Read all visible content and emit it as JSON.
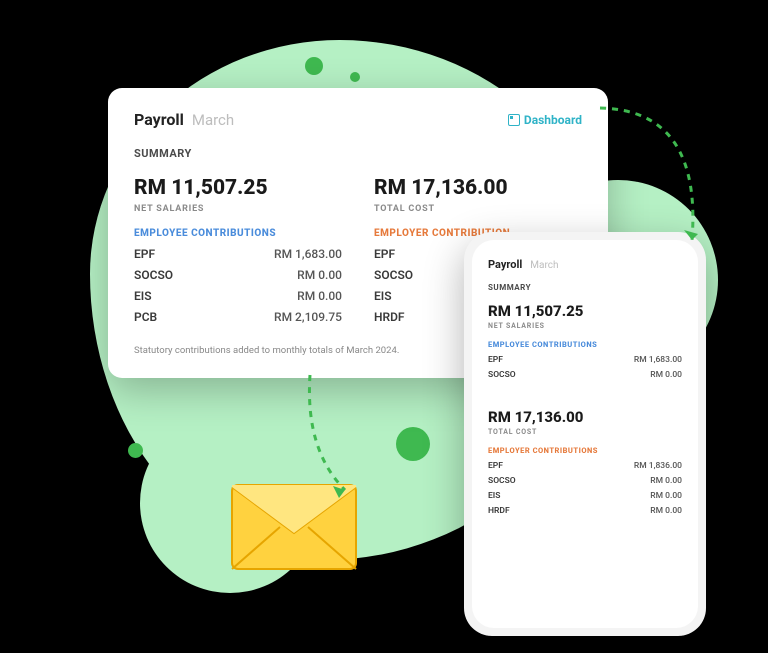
{
  "desktop": {
    "title": "Payroll",
    "month": "March",
    "dashboard_link": "Dashboard",
    "summary_label": "SUMMARY",
    "net_salaries": {
      "value": "RM 11,507.25",
      "label": "NET SALARIES"
    },
    "total_cost": {
      "value": "RM 17,136.00",
      "label": "TOTAL COST"
    },
    "employee_section": "EMPLOYEE CONTRIBUTIONS",
    "employer_section": "EMPLOYER CONTRIBUTION",
    "employee_rows": [
      {
        "label": "EPF",
        "value": "RM 1,683.00"
      },
      {
        "label": "SOCSO",
        "value": "RM 0.00"
      },
      {
        "label": "EIS",
        "value": "RM 0.00"
      },
      {
        "label": "PCB",
        "value": "RM 2,109.75"
      }
    ],
    "employer_rows": [
      {
        "label": "EPF",
        "value": ""
      },
      {
        "label": "SOCSO",
        "value": ""
      },
      {
        "label": "EIS",
        "value": ""
      },
      {
        "label": "HRDF",
        "value": ""
      }
    ],
    "note": "Statutory contributions added to monthly totals of March 2024."
  },
  "mobile": {
    "title": "Payroll",
    "month": "March",
    "summary_label": "SUMMARY",
    "net_salaries": {
      "value": "RM 11,507.25",
      "label": "NET SALARIES"
    },
    "total_cost": {
      "value": "RM 17,136.00",
      "label": "TOTAL COST"
    },
    "employee_section": "EMPLOYEE CONTRIBUTIONS",
    "employer_section": "EMPLOYER CONTRIBUTIONS",
    "employee_rows": [
      {
        "label": "EPF",
        "value": "RM 1,683.00"
      },
      {
        "label": "SOCSO",
        "value": "RM 0.00"
      }
    ],
    "employer_rows": [
      {
        "label": "EPF",
        "value": "RM 1,836.00"
      },
      {
        "label": "SOCSO",
        "value": "RM 0.00"
      },
      {
        "label": "EIS",
        "value": "RM 0.00"
      },
      {
        "label": "HRDF",
        "value": "RM 0.00"
      }
    ]
  }
}
